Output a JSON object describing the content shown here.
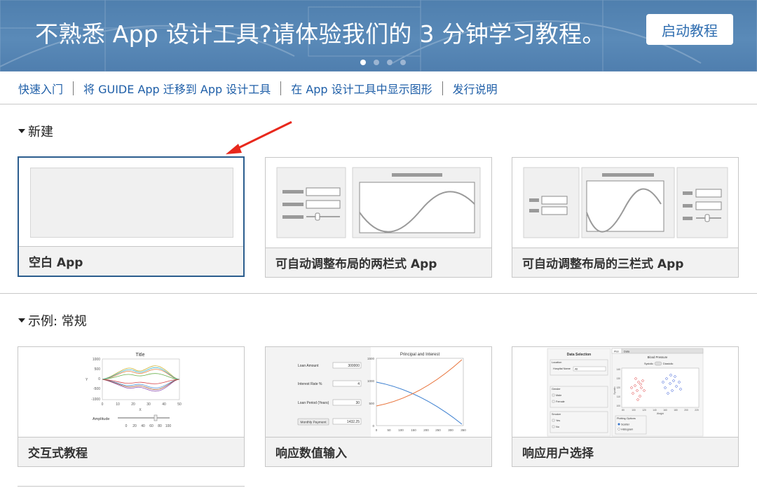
{
  "banner": {
    "title": "不熟悉 App 设计工具?请体验我们的 3 分钟学习教程。",
    "button_label": "启动教程",
    "page_count": 4,
    "active_page": 1
  },
  "links": [
    {
      "label": "快速入门"
    },
    {
      "label": "将 GUIDE App 迁移到 App 设计工具"
    },
    {
      "label": "在 App 设计工具中显示图形"
    },
    {
      "label": "发行说明"
    }
  ],
  "sections": {
    "new": {
      "title": "新建",
      "cards": [
        {
          "label": "空白 App"
        },
        {
          "label": "可自动调整布局的两栏式 App"
        },
        {
          "label": "可自动调整布局的三栏式 App"
        }
      ]
    },
    "examples": {
      "title": "示例: 常规",
      "cards": [
        {
          "label": "交互式教程"
        },
        {
          "label": "响应数值输入"
        },
        {
          "label": "响应用户选择"
        }
      ]
    }
  },
  "thumbs": {
    "interactive": {
      "title": "Title",
      "yticks": [
        "1000",
        "500",
        "0",
        "-500",
        "-1000"
      ],
      "xticks": [
        "0",
        "10",
        "20",
        "30",
        "40",
        "50"
      ],
      "xlabel": "X",
      "ylabel": "Y",
      "slider_label": "Amplitude",
      "slider_ticks": [
        "0",
        "20",
        "40",
        "60",
        "80",
        "100"
      ]
    },
    "numeric": {
      "chart_title": "Principal and Interest",
      "fields": [
        {
          "label": "Loan Amount",
          "value": "300000"
        },
        {
          "label": "Interest Rate %",
          "value": "4"
        },
        {
          "label": "Loan Period (Years)",
          "value": "30"
        }
      ],
      "button_label": "Monthly Payment",
      "payment_value": "1432.25",
      "yticks": [
        "1500",
        "1000",
        "500",
        "0"
      ],
      "xticks": [
        "0",
        "50",
        "100",
        "150",
        "200",
        "250",
        "300",
        "350"
      ]
    },
    "selection": {
      "panel_title": "Data Selection",
      "location_label": "Location",
      "hospital_label": "Hospital Name",
      "hospital_value": "All",
      "gender_label": "Gender",
      "gender_options": [
        "Male",
        "Female"
      ],
      "smoker_label": "Smoker",
      "smoker_options": [
        "Yes",
        "No"
      ],
      "tabs": [
        "Plot",
        "Data"
      ],
      "chart_title": "Blood Pressure",
      "toggle_left": "Systolic",
      "toggle_right": "Diastolic",
      "plotting_label": "Plotting Options",
      "plot_options": [
        "Scatter",
        "Histogram"
      ],
      "xlabel": "Weight",
      "ylabel": "Systolic",
      "xticks": [
        "80",
        "100",
        "120",
        "140",
        "160",
        "180",
        "200",
        "220"
      ],
      "yticks": [
        "140",
        "130",
        "120",
        "110",
        "100"
      ]
    }
  },
  "colors": {
    "banner": "#5585b3",
    "link": "#1f5fa8",
    "selected_border": "#2b5d8e",
    "arrow": "#e8281c"
  }
}
